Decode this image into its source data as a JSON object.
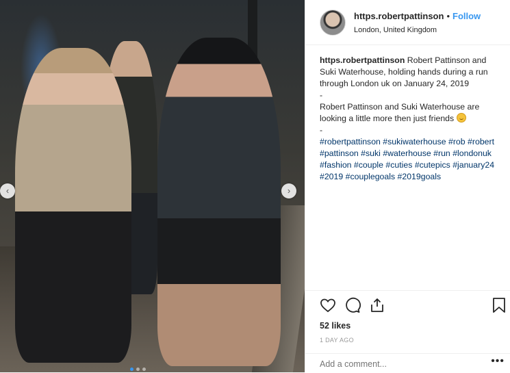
{
  "post": {
    "username": "https.robertpattinson",
    "separator": "•",
    "follow_label": "Follow",
    "location": "London, United Kingdom"
  },
  "caption": {
    "username": "https.robertpattinson",
    "line1": "Robert Pattinson and Suki Waterhouse, holding hands during a run through London uk on January 24, 2019",
    "dash1": "-",
    "line2": "Robert Pattinson and Suki Waterhouse are looking a little more then just friends",
    "dash2": "-",
    "hashtags": [
      "#robertpattinson",
      "#sukiwaterhouse",
      "#rob",
      "#robert",
      "#pattinson",
      "#suki",
      "#waterhouse",
      "#run",
      "#londonuk",
      "#fashion",
      "#couple",
      "#cuties",
      "#cutepics",
      "#january24",
      "#2019",
      "#couplegoals",
      "#2019goals"
    ]
  },
  "stats": {
    "likes": "52 likes",
    "time": "1 DAY AGO"
  },
  "comment": {
    "placeholder": "Add a comment...",
    "more": "•••"
  },
  "carousel": {
    "prev": "‹",
    "next": "›"
  },
  "icons": [
    "heart-icon",
    "comment-icon",
    "share-icon",
    "bookmark-icon",
    "smile-emoji-icon"
  ]
}
